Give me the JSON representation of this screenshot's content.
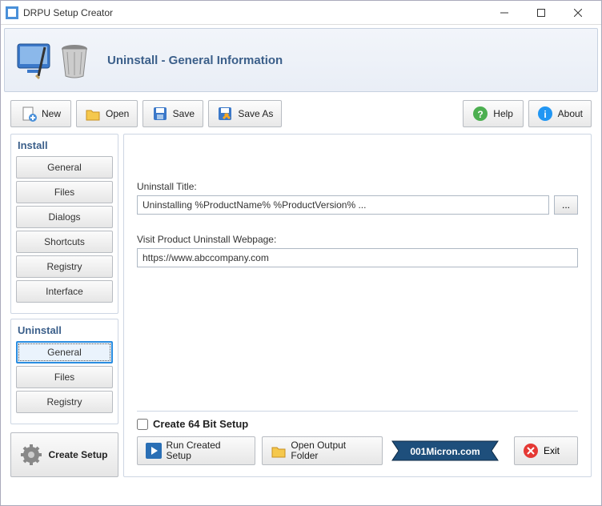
{
  "window": {
    "title": "DRPU Setup Creator"
  },
  "banner": {
    "heading": "Uninstall - General Information"
  },
  "toolbar": {
    "new": "New",
    "open": "Open",
    "save": "Save",
    "saveas": "Save As",
    "help": "Help",
    "about": "About"
  },
  "sidebar": {
    "install": {
      "title": "Install",
      "items": [
        "General",
        "Files",
        "Dialogs",
        "Shortcuts",
        "Registry",
        "Interface"
      ]
    },
    "uninstall": {
      "title": "Uninstall",
      "items": [
        "General",
        "Files",
        "Registry"
      ]
    },
    "create": "Create Setup"
  },
  "content": {
    "title_label": "Uninstall Title:",
    "title_value": "Uninstalling %ProductName% %ProductVersion% ...",
    "webpage_label": "Visit Product Uninstall Webpage:",
    "webpage_value": "https://www.abccompany.com"
  },
  "bottom": {
    "checkbox": "Create 64 Bit Setup",
    "run": "Run Created Setup",
    "folder": "Open Output Folder",
    "exit": "Exit",
    "watermark": "001Micron.com"
  }
}
